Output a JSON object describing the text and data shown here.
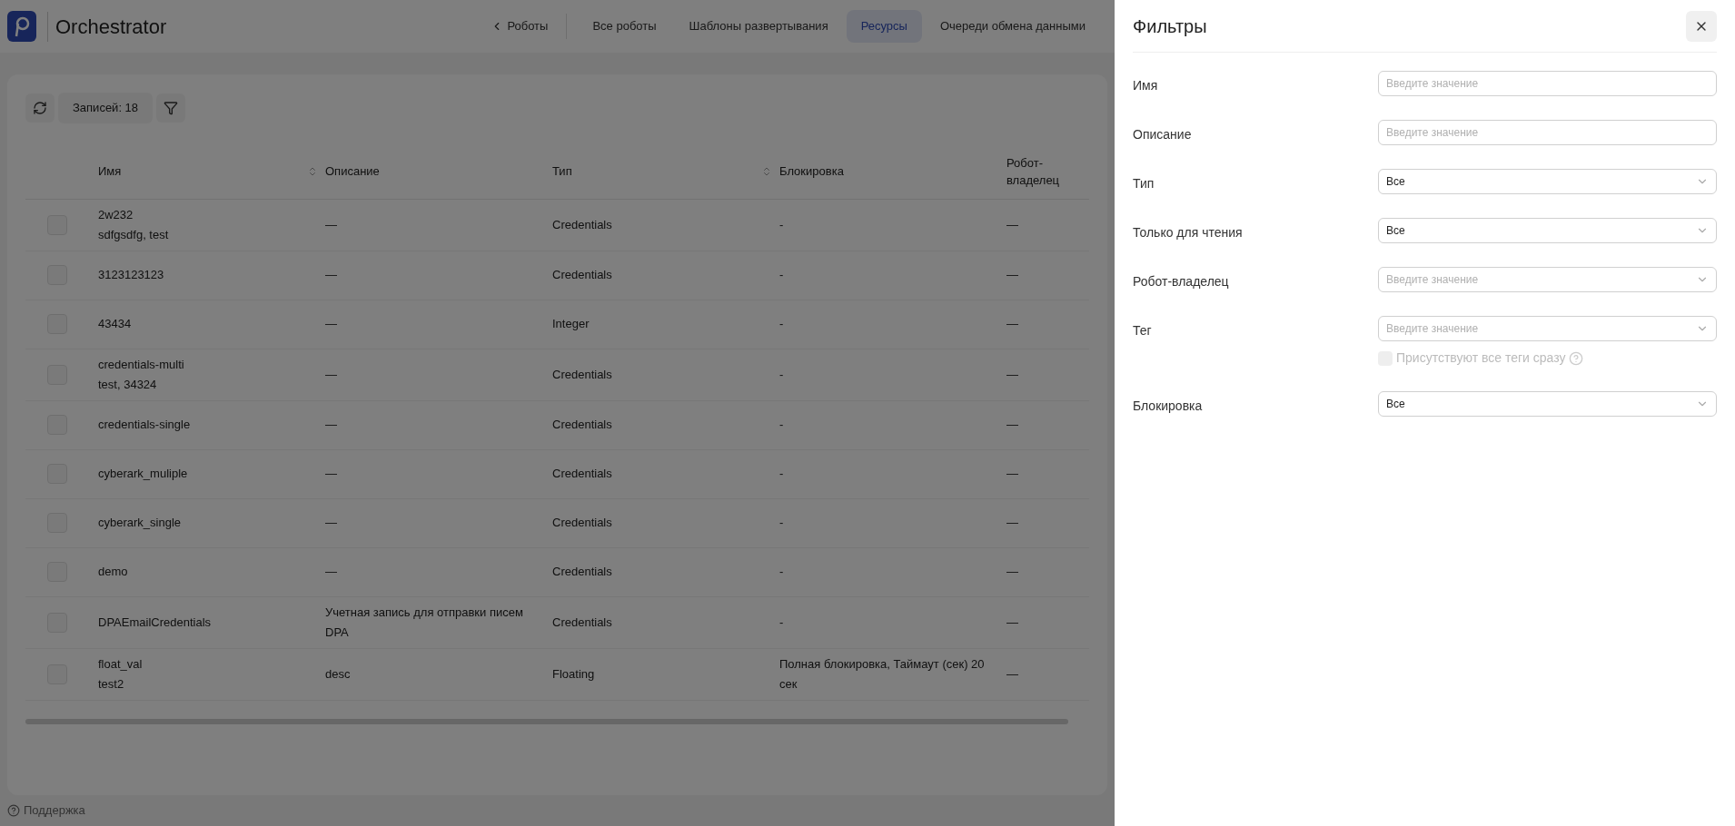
{
  "header": {
    "title": "Orchestrator",
    "nav": [
      {
        "label": "Роботы",
        "kind": "back",
        "selected": false
      },
      {
        "label": "Все роботы",
        "kind": "link",
        "selected": false
      },
      {
        "label": "Шаблоны развертывания",
        "kind": "link",
        "selected": false
      },
      {
        "label": "Ресурсы",
        "kind": "link",
        "selected": true
      },
      {
        "label": "Очереди обмена данными",
        "kind": "link",
        "selected": false
      }
    ]
  },
  "toolbar": {
    "count": "Записей: 18"
  },
  "table": {
    "columns": [
      {
        "label": "Имя",
        "sortable": true
      },
      {
        "label": "Описание",
        "sortable": false
      },
      {
        "label": "Тип",
        "sortable": true
      },
      {
        "label": "Блокировка",
        "sortable": false
      },
      {
        "label": "Робот-владелец",
        "sortable": false
      }
    ],
    "rows": [
      {
        "selected": false,
        "cells": [
          [
            "2w232",
            "sdfgsdfg, test"
          ],
          [
            "—"
          ],
          [
            "Credentials"
          ],
          [
            "-"
          ],
          [
            "—"
          ]
        ]
      },
      {
        "selected": false,
        "cells": [
          [
            "3123123123"
          ],
          [
            "—"
          ],
          [
            "Credentials"
          ],
          [
            "-"
          ],
          [
            "—"
          ]
        ]
      },
      {
        "selected": false,
        "cells": [
          [
            "43434"
          ],
          [
            "—"
          ],
          [
            "Integer"
          ],
          [
            "-"
          ],
          [
            "—"
          ]
        ]
      },
      {
        "selected": false,
        "cells": [
          [
            "credentials-multi",
            "test, 34324"
          ],
          [
            "—"
          ],
          [
            "Credentials"
          ],
          [
            "-"
          ],
          [
            "—"
          ]
        ]
      },
      {
        "selected": false,
        "cells": [
          [
            "credentials-single"
          ],
          [
            "—"
          ],
          [
            "Credentials"
          ],
          [
            "-"
          ],
          [
            "—"
          ]
        ]
      },
      {
        "selected": false,
        "cells": [
          [
            "cyberark_muliple"
          ],
          [
            "—"
          ],
          [
            "Credentials"
          ],
          [
            "-"
          ],
          [
            "—"
          ]
        ]
      },
      {
        "selected": false,
        "cells": [
          [
            "cyberark_single"
          ],
          [
            "—"
          ],
          [
            "Credentials"
          ],
          [
            "-"
          ],
          [
            "—"
          ]
        ]
      },
      {
        "selected": false,
        "cells": [
          [
            "demo"
          ],
          [
            "—"
          ],
          [
            "Credentials"
          ],
          [
            "-"
          ],
          [
            "—"
          ]
        ]
      },
      {
        "selected": false,
        "cells": [
          [
            "DPAEmailCredentials"
          ],
          [
            "Учетная запись для отправки писем",
            "DPA"
          ],
          [
            "Credentials"
          ],
          [
            "-"
          ],
          [
            "—"
          ]
        ]
      },
      {
        "selected": false,
        "cells": [
          [
            "float_val",
            "test2"
          ],
          [
            "desc"
          ],
          [
            "Floating"
          ],
          [
            "Полная блокировка, Таймаут (сек) 20",
            "сек"
          ],
          [
            "—"
          ]
        ]
      }
    ]
  },
  "footer": {
    "support": "Поддержка"
  },
  "drawer": {
    "title": "Фильтры",
    "fields": [
      {
        "label": "Имя",
        "kind": "input",
        "placeholder": "Введите значение"
      },
      {
        "label": "Описание",
        "kind": "input",
        "placeholder": "Введите значение"
      },
      {
        "label": "Тип",
        "kind": "select",
        "value": "Все"
      },
      {
        "label": "Только для чтения",
        "kind": "select",
        "value": "Все"
      },
      {
        "label": "Робот-владелец",
        "kind": "select",
        "placeholder": "Введите значение"
      },
      {
        "label": "Тег",
        "kind": "select",
        "placeholder": "Введите значение",
        "option": {
          "label": "Присутствуют все теги сразу",
          "checked": false,
          "disabled": true
        }
      },
      {
        "label": "Блокировка",
        "kind": "select",
        "value": "Все"
      }
    ]
  }
}
